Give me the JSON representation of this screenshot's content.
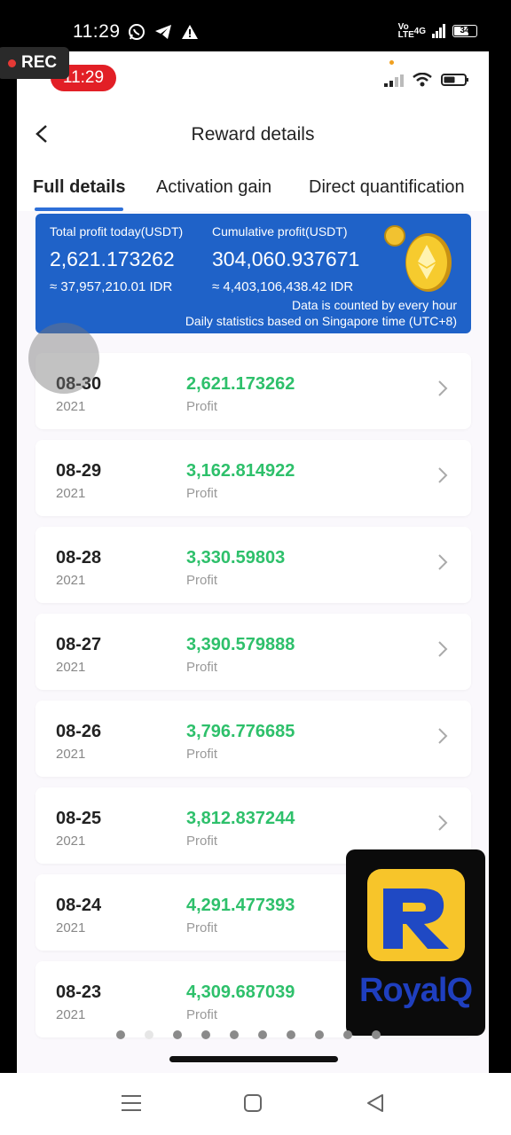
{
  "outer_status": {
    "time": "11:29",
    "net_top": "Vo",
    "net_bottom": "LTE",
    "net_type": "4G",
    "battery": "34"
  },
  "inner_status": {
    "time": "11:29"
  },
  "recording": {
    "label": "REC"
  },
  "header": {
    "title": "Reward details"
  },
  "tabs": [
    {
      "label": "Full details"
    },
    {
      "label": "Activation gain"
    },
    {
      "label": "Direct quantification"
    }
  ],
  "summary": {
    "today_label": "Total profit today(USDT)",
    "today_value": "2,621.173262",
    "today_idr": "≈ 37,957,210.01 IDR",
    "cumulative_label": "Cumulative profit(USDT)",
    "cumulative_value": "304,060.937671",
    "cumulative_idr": "≈ 4,403,106,438.42 IDR",
    "note1": "Data is counted by every hour",
    "note2": "Daily statistics based on Singapore time (UTC+8)"
  },
  "rows": [
    {
      "date": "08-30",
      "year": "2021",
      "amount": "2,621.173262",
      "sub": "Profit"
    },
    {
      "date": "08-29",
      "year": "2021",
      "amount": "3,162.814922",
      "sub": "Profit"
    },
    {
      "date": "08-28",
      "year": "2021",
      "amount": "3,330.59803",
      "sub": "Profit"
    },
    {
      "date": "08-27",
      "year": "2021",
      "amount": "3,390.579888",
      "sub": "Profit"
    },
    {
      "date": "08-26",
      "year": "2021",
      "amount": "3,796.776685",
      "sub": "Profit"
    },
    {
      "date": "08-25",
      "year": "2021",
      "amount": "3,812.837244",
      "sub": "Profit"
    },
    {
      "date": "08-24",
      "year": "2021",
      "amount": "4,291.477393",
      "sub": "Profit"
    },
    {
      "date": "08-23",
      "year": "2021",
      "amount": "4,309.687039",
      "sub": "Profit"
    }
  ],
  "watermark": {
    "text": "RoyalQ"
  },
  "colors": {
    "accent": "#1f62c8",
    "profit": "#2ec06b",
    "rec_badge": "#e21f26"
  }
}
